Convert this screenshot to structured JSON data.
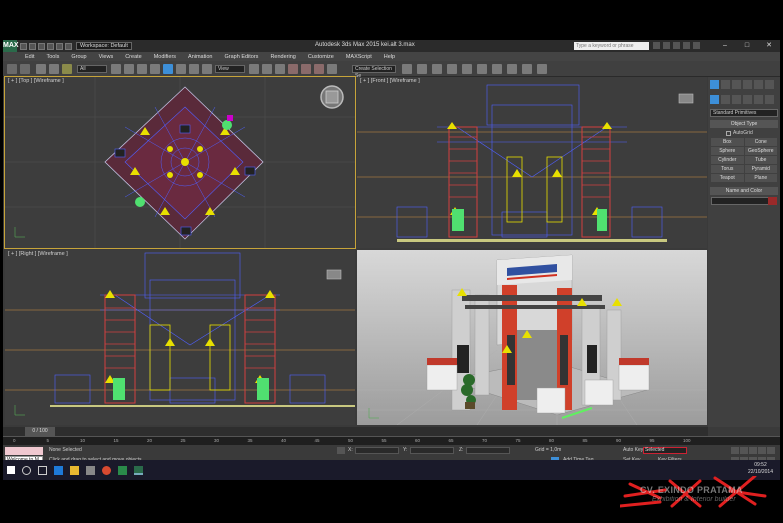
{
  "app": {
    "logo": "MAX",
    "workspace": "Workspace: Default",
    "title": "Autodesk 3ds Max 2015   kei.alt 3.max",
    "search_placeholder": "Type a keyword or phrase",
    "win_min": "–",
    "win_max": "□",
    "win_close": "✕"
  },
  "menu": [
    "Edit",
    "Tools",
    "Group",
    "Views",
    "Create",
    "Modifiers",
    "Animation",
    "Graph Editors",
    "Rendering",
    "Customize",
    "MAXScript",
    "Help"
  ],
  "toolbar": {
    "filter": "All",
    "view": "View",
    "selection_set": "Create Selection Se"
  },
  "viewports": {
    "top": "[ + ] [Top ] [Wireframe ]",
    "front": "[ + ] [Front ] [Wireframe ]",
    "right": "[ + ] [Right ] [Wireframe ]",
    "persp": ""
  },
  "panel": {
    "dropdown": "Standard Primitives",
    "object_type": "Object Type",
    "autogrid": "AutoGrid",
    "objects": [
      "Box",
      "Cone",
      "Sphere",
      "GeoSphere",
      "Cylinder",
      "Tube",
      "Torus",
      "Pyramid",
      "Teapot",
      "Plane"
    ],
    "name_color": "Name and Color"
  },
  "timeline": {
    "frame": "0 / 100",
    "ticks": [
      "0",
      "5",
      "10",
      "15",
      "20",
      "25",
      "30",
      "35",
      "40",
      "45",
      "50",
      "55",
      "60",
      "65",
      "70",
      "75",
      "80",
      "85",
      "90",
      "95",
      "100"
    ]
  },
  "status": {
    "listener": "Welcome to M",
    "selection": "None Selected",
    "prompt": "Click and drag to select and move objects",
    "x_label": "X:",
    "y_label": "Y:",
    "z_label": "Z:",
    "grid": "Grid = 1,0m",
    "add_time_tag": "Add Time Tag",
    "auto_key": "Auto Key",
    "auto_key_value": "Selected",
    "set_key": "Set Key",
    "key_filters": "Key Filters..."
  },
  "clock": {
    "time": "09:52",
    "date": "22/10/2014"
  },
  "watermark": {
    "name": "CV. EXINDO PRATAMA",
    "tagline": "Exhibition & Interior builder"
  },
  "colors": {
    "active_border": "#c7a43a",
    "wire_red": "#d24040",
    "wire_blue": "#5060ff",
    "light_yellow": "#e8e000",
    "plant_green": "#50e070"
  }
}
